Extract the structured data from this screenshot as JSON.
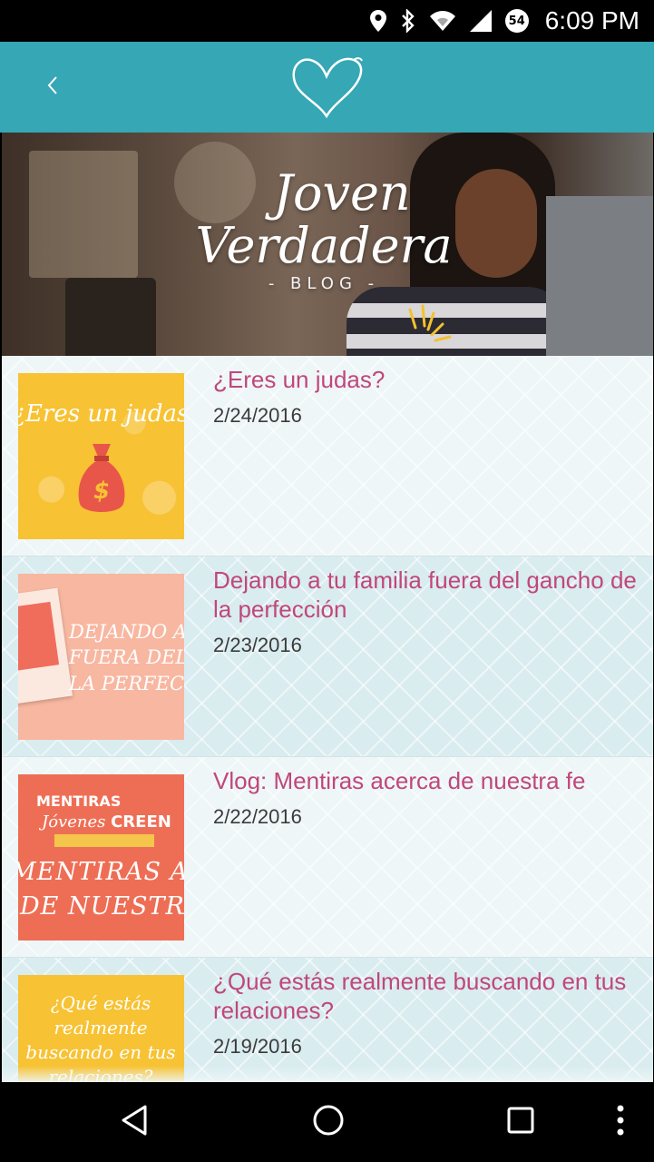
{
  "status_bar": {
    "battery_level": "54",
    "time": "6:09 PM",
    "icons": [
      "location-pin-icon",
      "bluetooth-icon",
      "wifi-icon",
      "cell-signal-icon",
      "battery-icon"
    ]
  },
  "app_bar": {
    "back_icon": "chevron-left-icon",
    "logo_icon": "heart-outline-icon",
    "color": "#35a7b5"
  },
  "banner": {
    "title_line1": "Joven",
    "title_line2": "Verdadera",
    "subtitle": "- BLOG -"
  },
  "posts": [
    {
      "title": "¿Eres un judas?",
      "date": "2/24/2016",
      "thumb_text": "¿Eres un judas?",
      "thumb_color": "#f7c233"
    },
    {
      "title": "Dejando a tu familia fuera del gancho de la perfección",
      "date": "2/23/2016",
      "thumb_text": "DEJANDO A TU FUERA DEL GANCHO LA PERFECCIÓN",
      "thumb_text_l1": "DEJANDO A TU",
      "thumb_text_l2": "FUERA DEL GA",
      "thumb_text_l3": "LA PERFECC",
      "thumb_color": "#f8b7a1"
    },
    {
      "title": "Vlog: Mentiras acerca de nuestra fe",
      "date": "2/22/2016",
      "thumb_line1": "MENTIRAS",
      "thumb_line2a": "Jóvenes",
      "thumb_line2b": "CREEN",
      "thumb_line3": "MENTIRAS ACERCA",
      "thumb_line4": "DE NUESTRA FE",
      "thumb_color": "#ee6e55"
    },
    {
      "title": "¿Qué estás realmente buscando en tus relaciones?",
      "date": "2/19/2016",
      "thumb_text": "¿Qué estás realmente buscando en tus relaciones?",
      "thumb_color": "#f7c233"
    }
  ],
  "colors": {
    "title": "#c0477c",
    "date": "#3b3b3b",
    "list_bg": "#eef6f7",
    "list_bg_alt": "#d9ecef"
  },
  "nav_bar": {
    "buttons": [
      "back-triangle-icon",
      "home-circle-icon",
      "recents-square-icon",
      "overflow-dots-icon"
    ]
  }
}
